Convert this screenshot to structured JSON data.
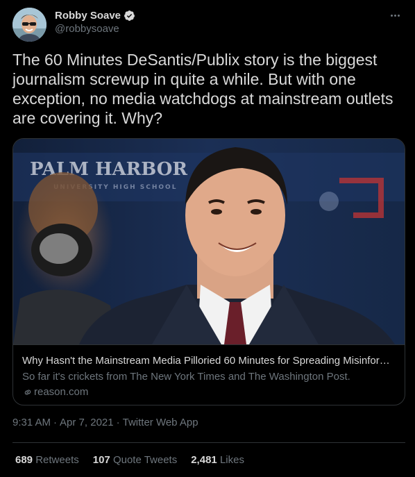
{
  "author": {
    "display_name": "Robby Soave",
    "handle": "@robbysoave",
    "verified": true,
    "verified_icon": "verified-badge-icon",
    "verified_color": "#d9d9d9"
  },
  "more_icon": "more-horizontal-icon",
  "tweet_text": "The 60 Minutes DeSantis/Publix story is the biggest journalism screwup in quite a while. But with one exception, no media watchdogs at mainstream outlets are covering it. Why?",
  "card": {
    "image_sign_text": "PALM HARBOR",
    "image_sign_subtext": "UNIVERSITY HIGH SCHOOL",
    "title": "Why Hasn't the Mainstream Media Pilloried 60 Minutes for Spreading Misinfor…",
    "description": "So far it's crickets from The New York Times and The Washington Post.",
    "domain": "reason.com",
    "domain_icon": "link-icon"
  },
  "meta": {
    "time": "9:31 AM",
    "separator": "·",
    "date": "Apr 7, 2021",
    "source": "Twitter Web App"
  },
  "stats": {
    "retweets_count": "689",
    "retweets_label": "Retweets",
    "quotes_count": "107",
    "quotes_label": "Quote Tweets",
    "likes_count": "2,481",
    "likes_label": "Likes"
  },
  "colors": {
    "background": "#000000",
    "text_primary": "#d9d9d9",
    "text_secondary": "#6e767d",
    "border": "#2f3336"
  }
}
